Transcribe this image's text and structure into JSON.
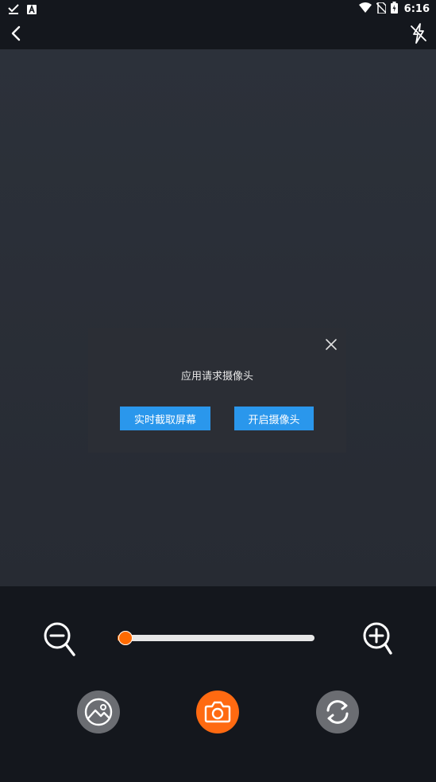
{
  "status_bar": {
    "time": "6:16",
    "icons": [
      "download-done-icon",
      "app-notification-icon",
      "wifi-icon",
      "no-sim-icon",
      "battery-charging-icon"
    ]
  },
  "top_bar": {
    "back_icon": "chevron-left-icon",
    "flash_icon": "flash-off-icon"
  },
  "dialog": {
    "message": "应用请求摄像头",
    "close_icon": "close-icon",
    "buttons": {
      "screen_capture": "实时截取屏幕",
      "open_camera": "开启摄像头"
    }
  },
  "zoom": {
    "out_icon": "zoom-out-icon",
    "in_icon": "zoom-in-icon",
    "level": 0.02
  },
  "actions": {
    "gallery_icon": "gallery-icon",
    "shutter_icon": "camera-icon",
    "switch_icon": "switch-camera-icon"
  },
  "colors": {
    "accent": "#ff6a00",
    "button_blue": "#2a97ec",
    "dialog_bg": "#2b2e35",
    "preview_bg": "#2c313a",
    "panel_bg": "#14171d"
  }
}
